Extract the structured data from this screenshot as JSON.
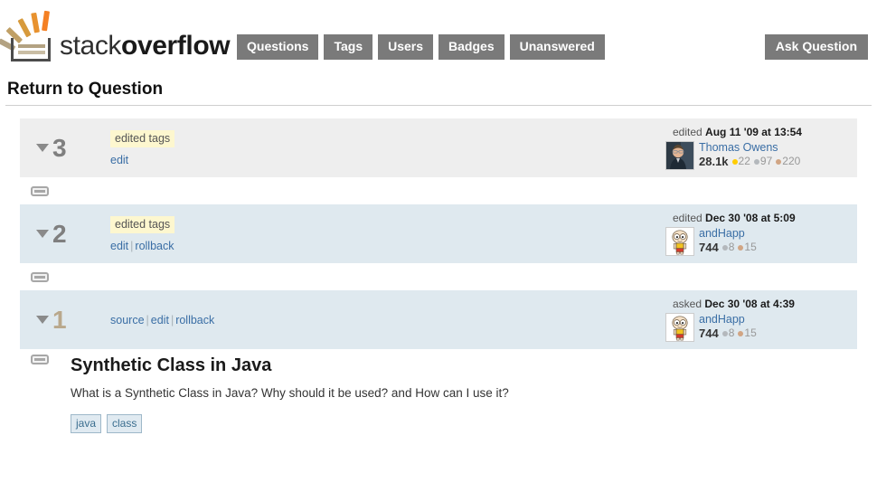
{
  "brand": {
    "logo_text_light": "stack",
    "logo_text_bold": "overflow",
    "logo_icon": "stackoverflow-logo-icon"
  },
  "nav": {
    "items": [
      {
        "label": "Questions",
        "name": "nav-questions"
      },
      {
        "label": "Tags",
        "name": "nav-tags"
      },
      {
        "label": "Users",
        "name": "nav-users"
      },
      {
        "label": "Badges",
        "name": "nav-badges"
      },
      {
        "label": "Unanswered",
        "name": "nav-unanswered"
      }
    ],
    "ask_label": "Ask Question"
  },
  "page": {
    "title": "Return to Question"
  },
  "revisions": [
    {
      "number": "3",
      "summary": "edited tags",
      "links": [
        "edit"
      ],
      "action": "edited",
      "timestamp": "Aug 11 '09 at 13:54",
      "user": {
        "name": "Thomas Owens",
        "reputation": "28.1k",
        "gold": "22",
        "silver": "97",
        "bronze": "220",
        "avatar": "photo-avatar"
      }
    },
    {
      "number": "2",
      "summary": "edited tags",
      "links": [
        "edit",
        "rollback"
      ],
      "action": "edited",
      "timestamp": "Dec 30 '08 at 5:09",
      "user": {
        "name": "andHapp",
        "reputation": "744",
        "gold": "",
        "silver": "8",
        "bronze": "15",
        "avatar": "cartoon-avatar"
      }
    },
    {
      "number": "1",
      "summary": "",
      "links": [
        "source",
        "edit",
        "rollback"
      ],
      "action": "asked",
      "timestamp": "Dec 30 '08 at 4:39",
      "user": {
        "name": "andHapp",
        "reputation": "744",
        "gold": "",
        "silver": "8",
        "bronze": "15",
        "avatar": "cartoon-avatar"
      }
    }
  ],
  "question": {
    "title": "Synthetic Class in Java",
    "body": "What is a Synthetic Class in Java? Why should it be used? and How can I use it?",
    "tags": [
      "java",
      "class"
    ]
  },
  "colors": {
    "accent_link": "#3a6ea5",
    "nav_button": "#7a7a7a",
    "row_gray": "#eeeeee",
    "row_blue": "#dfe9ef",
    "summary_badge": "#fdf7cf",
    "gold_badge": "#ffcc01",
    "silver_badge": "#b4b8bc",
    "bronze_badge": "#d1a584"
  }
}
